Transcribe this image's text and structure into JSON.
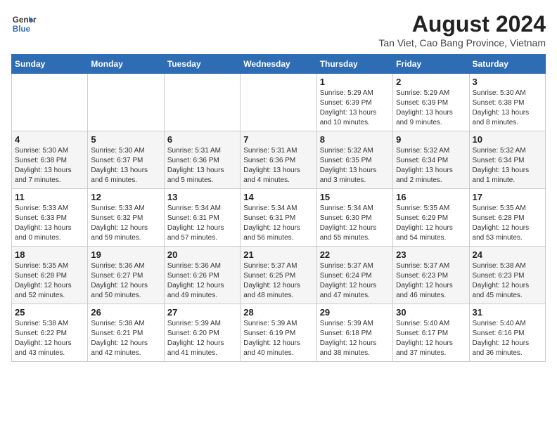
{
  "header": {
    "logo_line1": "General",
    "logo_line2": "Blue",
    "title": "August 2024",
    "subtitle": "Tan Viet, Cao Bang Province, Vietnam"
  },
  "weekdays": [
    "Sunday",
    "Monday",
    "Tuesday",
    "Wednesday",
    "Thursday",
    "Friday",
    "Saturday"
  ],
  "weeks": [
    [
      {
        "day": "",
        "info": ""
      },
      {
        "day": "",
        "info": ""
      },
      {
        "day": "",
        "info": ""
      },
      {
        "day": "",
        "info": ""
      },
      {
        "day": "1",
        "info": "Sunrise: 5:29 AM\nSunset: 6:39 PM\nDaylight: 13 hours\nand 10 minutes."
      },
      {
        "day": "2",
        "info": "Sunrise: 5:29 AM\nSunset: 6:39 PM\nDaylight: 13 hours\nand 9 minutes."
      },
      {
        "day": "3",
        "info": "Sunrise: 5:30 AM\nSunset: 6:38 PM\nDaylight: 13 hours\nand 8 minutes."
      }
    ],
    [
      {
        "day": "4",
        "info": "Sunrise: 5:30 AM\nSunset: 6:38 PM\nDaylight: 13 hours\nand 7 minutes."
      },
      {
        "day": "5",
        "info": "Sunrise: 5:30 AM\nSunset: 6:37 PM\nDaylight: 13 hours\nand 6 minutes."
      },
      {
        "day": "6",
        "info": "Sunrise: 5:31 AM\nSunset: 6:36 PM\nDaylight: 13 hours\nand 5 minutes."
      },
      {
        "day": "7",
        "info": "Sunrise: 5:31 AM\nSunset: 6:36 PM\nDaylight: 13 hours\nand 4 minutes."
      },
      {
        "day": "8",
        "info": "Sunrise: 5:32 AM\nSunset: 6:35 PM\nDaylight: 13 hours\nand 3 minutes."
      },
      {
        "day": "9",
        "info": "Sunrise: 5:32 AM\nSunset: 6:34 PM\nDaylight: 13 hours\nand 2 minutes."
      },
      {
        "day": "10",
        "info": "Sunrise: 5:32 AM\nSunset: 6:34 PM\nDaylight: 13 hours\nand 1 minute."
      }
    ],
    [
      {
        "day": "11",
        "info": "Sunrise: 5:33 AM\nSunset: 6:33 PM\nDaylight: 13 hours\nand 0 minutes."
      },
      {
        "day": "12",
        "info": "Sunrise: 5:33 AM\nSunset: 6:32 PM\nDaylight: 12 hours\nand 59 minutes."
      },
      {
        "day": "13",
        "info": "Sunrise: 5:34 AM\nSunset: 6:31 PM\nDaylight: 12 hours\nand 57 minutes."
      },
      {
        "day": "14",
        "info": "Sunrise: 5:34 AM\nSunset: 6:31 PM\nDaylight: 12 hours\nand 56 minutes."
      },
      {
        "day": "15",
        "info": "Sunrise: 5:34 AM\nSunset: 6:30 PM\nDaylight: 12 hours\nand 55 minutes."
      },
      {
        "day": "16",
        "info": "Sunrise: 5:35 AM\nSunset: 6:29 PM\nDaylight: 12 hours\nand 54 minutes."
      },
      {
        "day": "17",
        "info": "Sunrise: 5:35 AM\nSunset: 6:28 PM\nDaylight: 12 hours\nand 53 minutes."
      }
    ],
    [
      {
        "day": "18",
        "info": "Sunrise: 5:35 AM\nSunset: 6:28 PM\nDaylight: 12 hours\nand 52 minutes."
      },
      {
        "day": "19",
        "info": "Sunrise: 5:36 AM\nSunset: 6:27 PM\nDaylight: 12 hours\nand 50 minutes."
      },
      {
        "day": "20",
        "info": "Sunrise: 5:36 AM\nSunset: 6:26 PM\nDaylight: 12 hours\nand 49 minutes."
      },
      {
        "day": "21",
        "info": "Sunrise: 5:37 AM\nSunset: 6:25 PM\nDaylight: 12 hours\nand 48 minutes."
      },
      {
        "day": "22",
        "info": "Sunrise: 5:37 AM\nSunset: 6:24 PM\nDaylight: 12 hours\nand 47 minutes."
      },
      {
        "day": "23",
        "info": "Sunrise: 5:37 AM\nSunset: 6:23 PM\nDaylight: 12 hours\nand 46 minutes."
      },
      {
        "day": "24",
        "info": "Sunrise: 5:38 AM\nSunset: 6:23 PM\nDaylight: 12 hours\nand 45 minutes."
      }
    ],
    [
      {
        "day": "25",
        "info": "Sunrise: 5:38 AM\nSunset: 6:22 PM\nDaylight: 12 hours\nand 43 minutes."
      },
      {
        "day": "26",
        "info": "Sunrise: 5:38 AM\nSunset: 6:21 PM\nDaylight: 12 hours\nand 42 minutes."
      },
      {
        "day": "27",
        "info": "Sunrise: 5:39 AM\nSunset: 6:20 PM\nDaylight: 12 hours\nand 41 minutes."
      },
      {
        "day": "28",
        "info": "Sunrise: 5:39 AM\nSunset: 6:19 PM\nDaylight: 12 hours\nand 40 minutes."
      },
      {
        "day": "29",
        "info": "Sunrise: 5:39 AM\nSunset: 6:18 PM\nDaylight: 12 hours\nand 38 minutes."
      },
      {
        "day": "30",
        "info": "Sunrise: 5:40 AM\nSunset: 6:17 PM\nDaylight: 12 hours\nand 37 minutes."
      },
      {
        "day": "31",
        "info": "Sunrise: 5:40 AM\nSunset: 6:16 PM\nDaylight: 12 hours\nand 36 minutes."
      }
    ]
  ]
}
